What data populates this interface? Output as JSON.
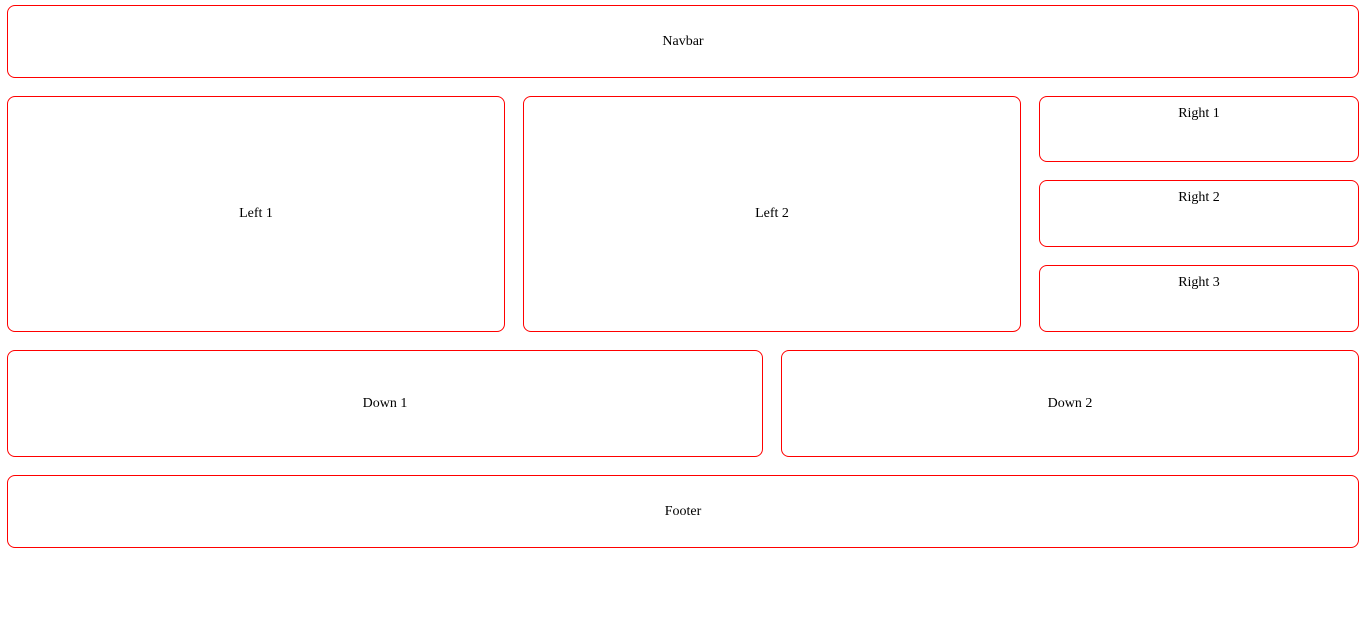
{
  "navbar": {
    "label": "Navbar"
  },
  "left": [
    {
      "label": "Left 1"
    },
    {
      "label": "Left 2"
    }
  ],
  "right": [
    {
      "label": "Right 1"
    },
    {
      "label": "Right 2"
    },
    {
      "label": "Right 3"
    }
  ],
  "down": [
    {
      "label": "Down 1"
    },
    {
      "label": "Down 2"
    }
  ],
  "footer": {
    "label": "Footer"
  },
  "colors": {
    "border": "#ff0000",
    "background": "#ffffff",
    "text": "#000000"
  }
}
